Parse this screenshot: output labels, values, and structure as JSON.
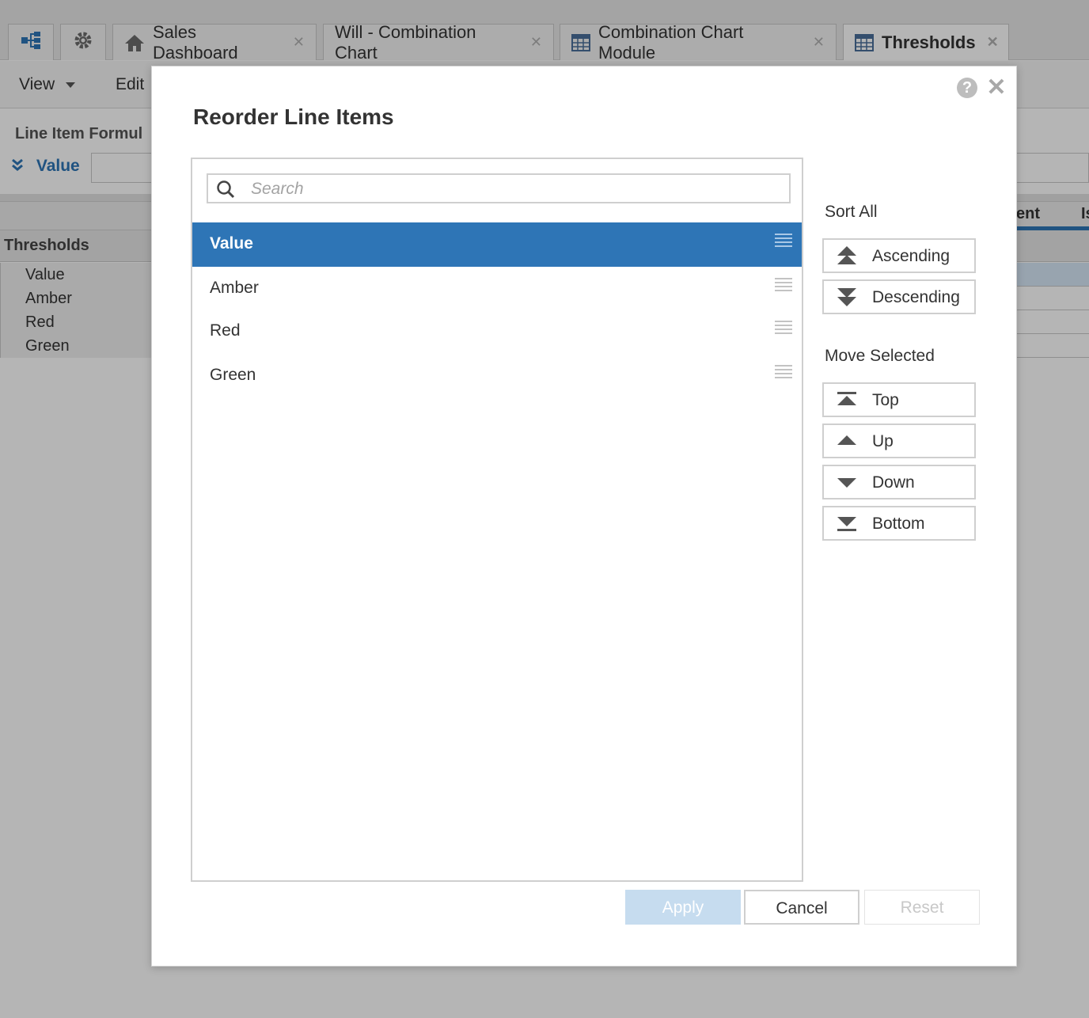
{
  "colors": {
    "accent": "#2e75b6",
    "apply_disabled": "#c6dcef"
  },
  "tabs": [
    {
      "icon": "hierarchy-icon"
    },
    {
      "icon": "gear-icon"
    },
    {
      "label": "Sales Dashboard",
      "icon": "home-icon"
    },
    {
      "label": "Will - Combination Chart"
    },
    {
      "label": "Combination Chart Module",
      "icon": "grid-icon"
    },
    {
      "label": "Thresholds",
      "icon": "grid-icon",
      "active": true
    }
  ],
  "menubar": {
    "view": "View",
    "edit": "Edit"
  },
  "background": {
    "formula_label": "Line Item Formul",
    "value_selector": "Value",
    "grid_title": "Thresholds",
    "rows": [
      "Value",
      "Amber",
      "Red",
      "Green"
    ],
    "right_headers": [
      "ent",
      "Is"
    ]
  },
  "dialog": {
    "title": "Reorder Line Items",
    "search_placeholder": "Search",
    "items": [
      {
        "label": "Value",
        "selected": true
      },
      {
        "label": "Amber",
        "selected": false
      },
      {
        "label": "Red",
        "selected": false
      },
      {
        "label": "Green",
        "selected": false
      }
    ],
    "sort_all_label": "Sort All",
    "ascending": "Ascending",
    "descending": "Descending",
    "move_selected_label": "Move Selected",
    "top": "Top",
    "up": "Up",
    "down": "Down",
    "bottom": "Bottom",
    "apply": "Apply",
    "cancel": "Cancel",
    "reset": "Reset"
  }
}
